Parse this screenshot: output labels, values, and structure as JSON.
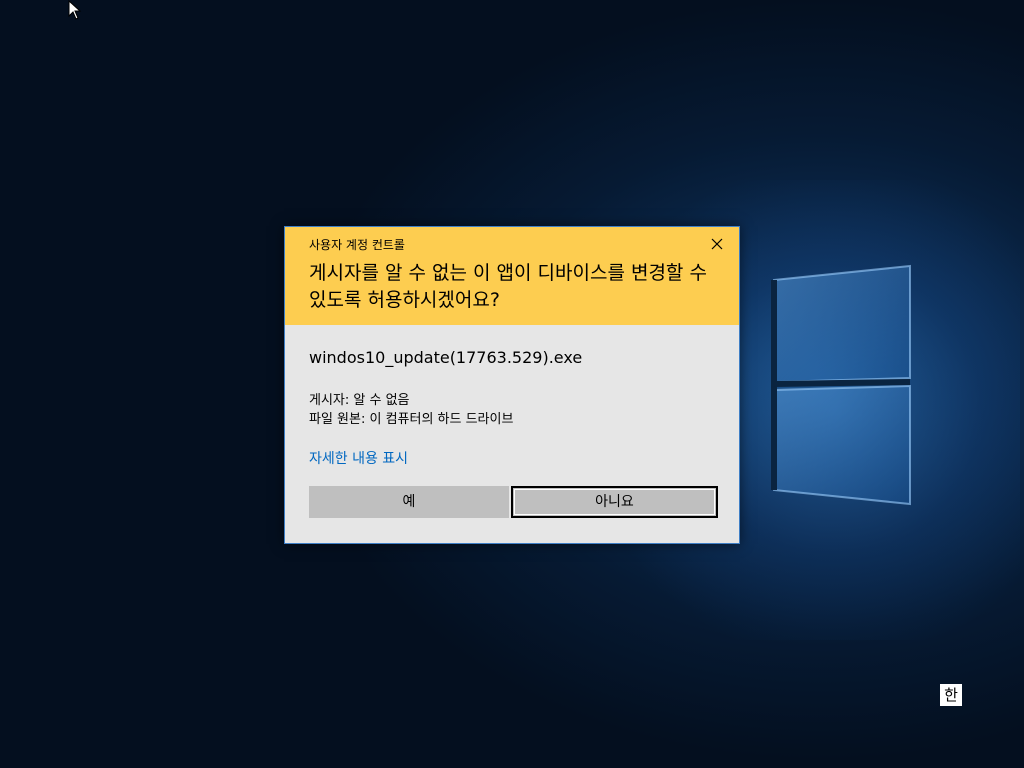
{
  "uac": {
    "caption": "사용자 계정 컨트롤",
    "question": "게시자를 알 수 없는 이 앱이 디바이스를 변경할 수 있도록 허용하시겠어요?",
    "program_name": "windos10_update(17763.529).exe",
    "publisher_line": "게시자: 알 수 없음",
    "origin_line": "파일 원본: 이 컴퓨터의 하드 드라이브",
    "details_link": "자세한 내용 표시",
    "yes_label": "예",
    "no_label": "아니요",
    "header_color": "#fdcd50",
    "link_color": "#0067c0"
  },
  "tray": {
    "ime_mode": "한"
  },
  "icons": {
    "close": "close-icon",
    "cursor": "mouse-pointer-icon",
    "logo": "windows-logo-icon"
  }
}
